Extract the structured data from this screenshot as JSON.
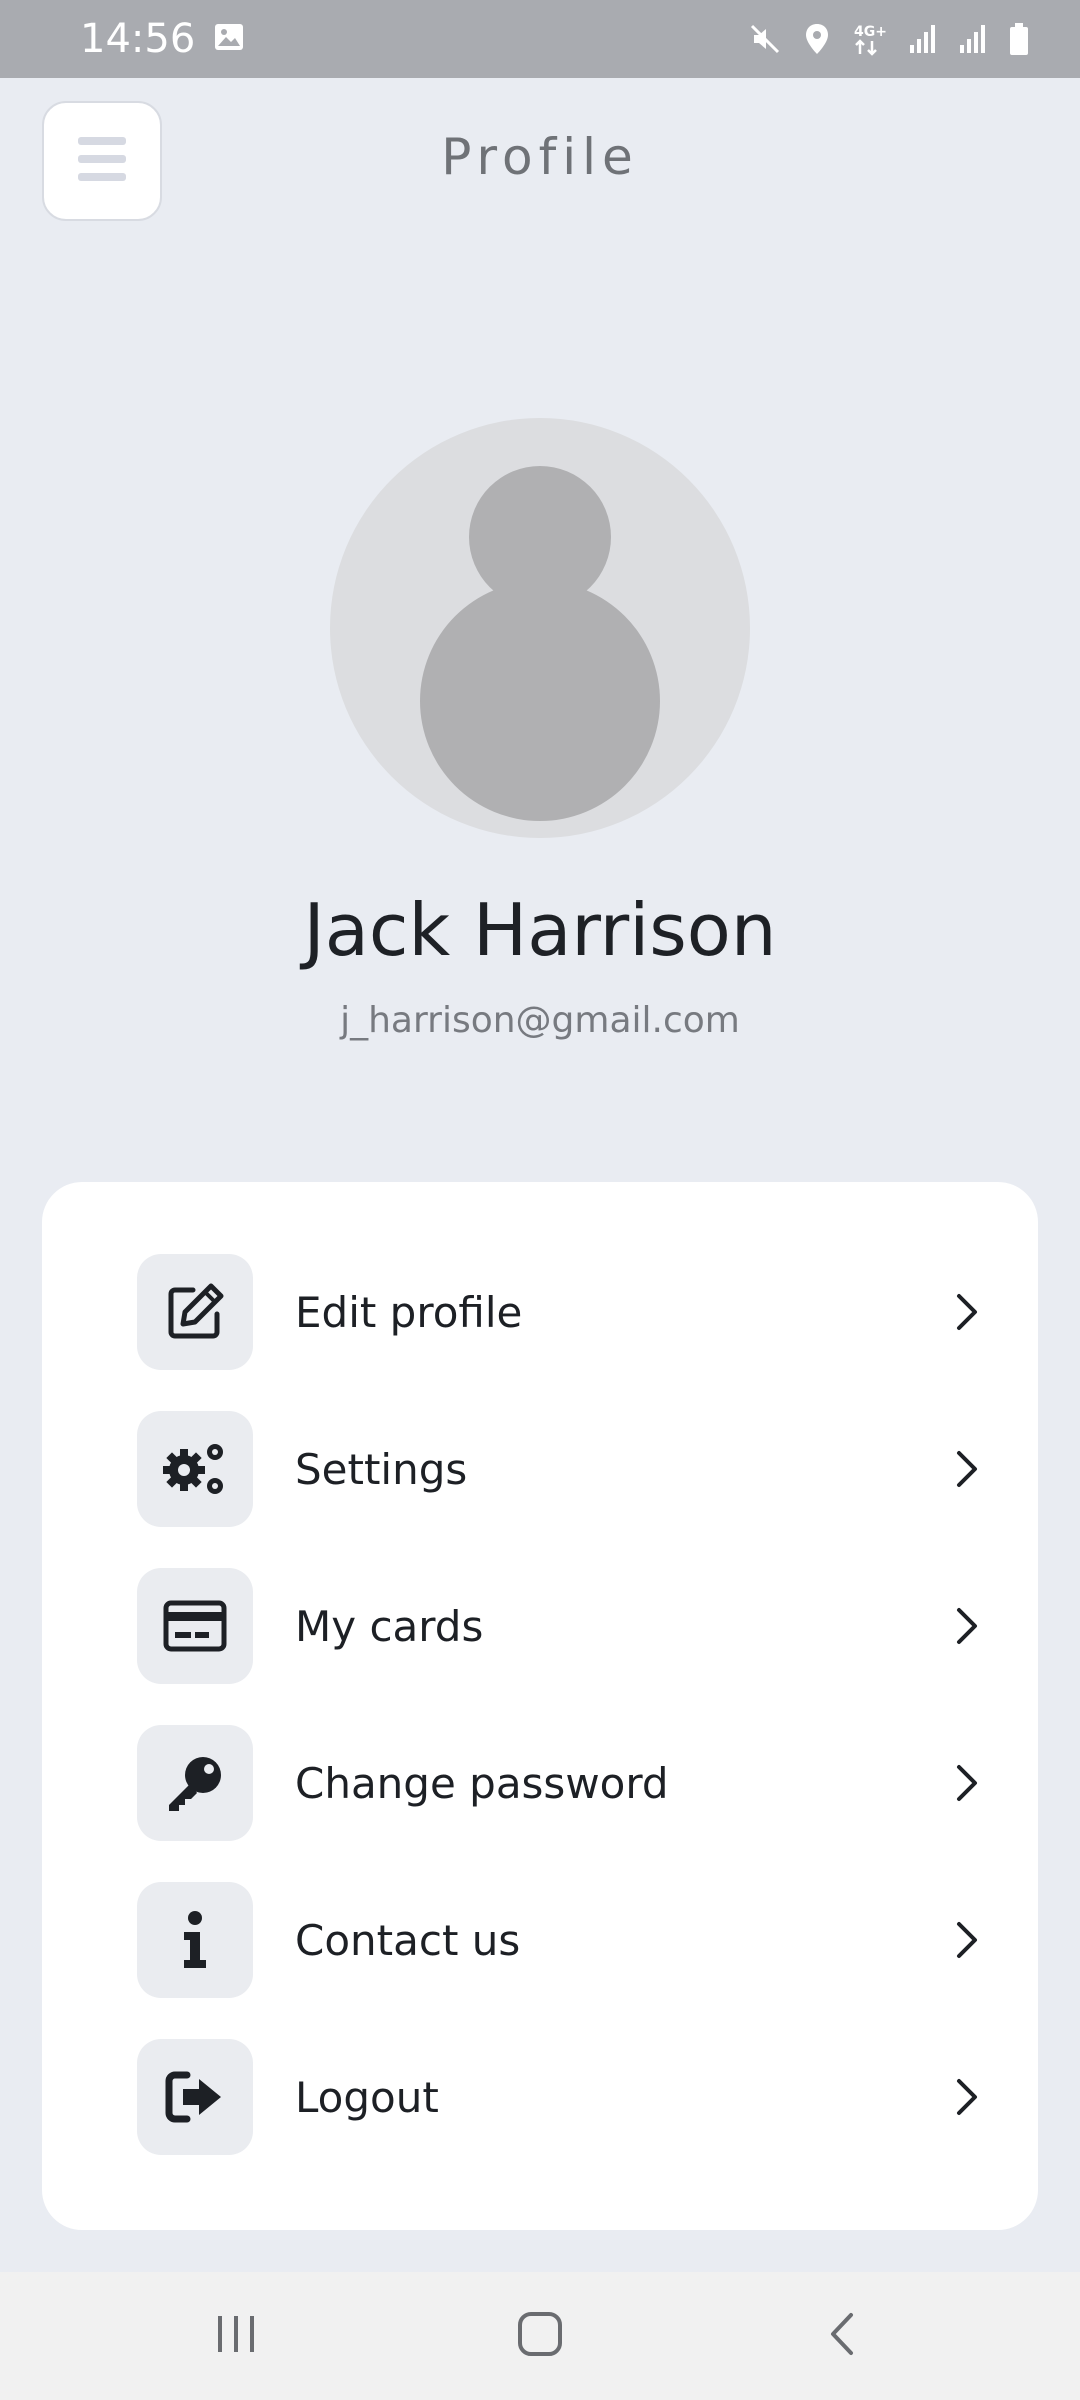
{
  "status_bar": {
    "time": "14:56",
    "icons": [
      "gallery-icon",
      "mute-icon",
      "location-icon",
      "4g-icon",
      "signal-icon",
      "signal-icon",
      "battery-icon"
    ],
    "network_label": "4G+"
  },
  "header": {
    "title": "Profile",
    "menu_icon": "hamburger-menu-icon"
  },
  "profile": {
    "name": "Jack Harrison",
    "email": "j_harrison@gmail.com",
    "avatar_icon": "user-avatar-placeholder"
  },
  "menu": {
    "items": [
      {
        "label": "Edit profile",
        "icon": "edit-icon"
      },
      {
        "label": "Settings",
        "icon": "gears-icon"
      },
      {
        "label": "My cards",
        "icon": "credit-card-icon"
      },
      {
        "label": "Change password",
        "icon": "key-icon"
      },
      {
        "label": "Contact us",
        "icon": "info-icon"
      },
      {
        "label": "Logout",
        "icon": "logout-icon"
      }
    ]
  },
  "nav_bar": {
    "buttons": [
      "recents-icon",
      "home-icon",
      "back-icon"
    ]
  },
  "colors": {
    "background": "#e9ecf2",
    "card": "#ffffff",
    "icon_tile": "#eaecf0",
    "text_primary": "#1d2025",
    "text_secondary": "#777a80",
    "status_bar": "#a9abb0"
  }
}
